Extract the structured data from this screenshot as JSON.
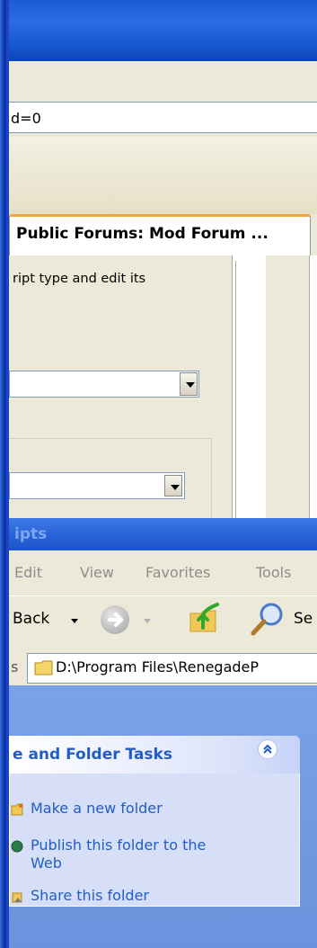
{
  "browser": {
    "address_text": "d=0",
    "tab_label": "Public Forums: Mod Forum ...",
    "panel_text": "ript type and edit its"
  },
  "explorer": {
    "title": "ipts",
    "menu": [
      "Edit",
      "View",
      "Favorites",
      "Tools"
    ],
    "toolbar": {
      "back_label": "Back",
      "search_label": "Se"
    },
    "address_label": "s",
    "address_text": "D:\\Program Files\\RenegadeP",
    "tasks": {
      "title": "e and Folder Tasks",
      "items": [
        {
          "icon": "new-folder-icon",
          "label": "Make a new folder"
        },
        {
          "icon": "publish-web-icon",
          "label": "Publish this folder to the\nWeb"
        },
        {
          "icon": "share-folder-icon",
          "label": "Share this folder"
        }
      ]
    }
  },
  "colors": {
    "title_blue": "#2a64d8",
    "task_link": "#215dc6",
    "sidebar_blue": "#7ba2e7",
    "tab_accent": "#f2a53b"
  }
}
